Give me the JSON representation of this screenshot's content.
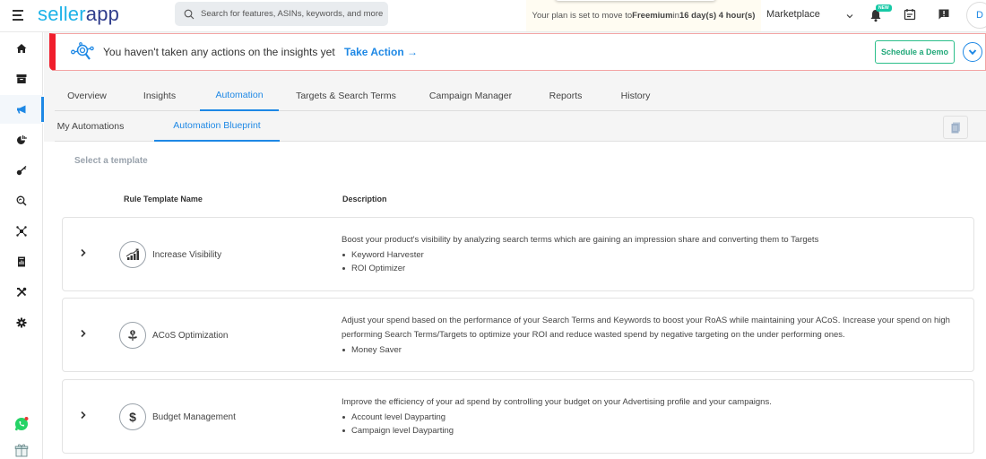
{
  "topbar": {
    "logo_part1": "seller",
    "logo_part2": "app",
    "search_placeholder": "Search for features, ASINs, keywords, and more",
    "plan_text_pre": "Your plan is set to move to ",
    "plan_name": "Freemium",
    "plan_text_mid": " in ",
    "plan_time": "16 day(s) 4 hour(s)",
    "marketplace_label": "Marketplace",
    "new_badge": "NEW",
    "avatar_initial": "D"
  },
  "sidebar": {
    "items": [
      {
        "name": "home",
        "icon": "home-icon"
      },
      {
        "name": "inventory",
        "icon": "archive-icon"
      },
      {
        "name": "advertising",
        "icon": "megaphone-icon",
        "active": true
      },
      {
        "name": "analytics",
        "icon": "pie-chart-icon"
      },
      {
        "name": "keywords",
        "icon": "key-icon"
      },
      {
        "name": "product-research",
        "icon": "search-zoom-icon"
      },
      {
        "name": "integrations",
        "icon": "network-icon"
      },
      {
        "name": "reports",
        "icon": "report-icon"
      },
      {
        "name": "tools",
        "icon": "tools-icon"
      },
      {
        "name": "settings",
        "icon": "gear-icon"
      }
    ],
    "bottom": [
      "whatsapp-icon",
      "gift-icon"
    ]
  },
  "banner": {
    "message": "You haven't taken any actions on the insights yet",
    "action_label": "Take Action →",
    "demo_button": "Schedule a Demo"
  },
  "tabs": [
    {
      "label": "Overview"
    },
    {
      "label": "Insights"
    },
    {
      "label": "Automation",
      "active": true
    },
    {
      "label": "Targets & Search Terms"
    },
    {
      "label": "Campaign Manager"
    },
    {
      "label": "Reports"
    },
    {
      "label": "History"
    }
  ],
  "subtabs": [
    {
      "label": "My Automations"
    },
    {
      "label": "Automation Blueprint",
      "active": true
    }
  ],
  "content": {
    "select_label": "Select a template",
    "columns": {
      "name": "Rule Template Name",
      "description": "Description"
    },
    "templates": [
      {
        "name": "Increase Visibility",
        "icon": "growth-chart-icon",
        "description": "Boost your product's visibility by analyzing search terms which are gaining an impression share and converting them to Targets",
        "rules": [
          "Keyword Harvester",
          "ROI Optimizer"
        ]
      },
      {
        "name": "ACoS Optimization",
        "icon": "money-plant-icon",
        "description": "Adjust your spend based on the performance of your Search Terms and Keywords to boost your RoAS while maintaining your ACoS. Increase your spend on high performing Search Terms/Targets to optimize your ROI and reduce wasted spend by negative targeting on the under performing ones.",
        "rules": [
          "Money Saver"
        ]
      },
      {
        "name": "Budget Management",
        "icon": "dollar-icon",
        "description": "Improve the efficiency of your ad spend by controlling your budget on your Advertising profile and your campaigns.",
        "rules": [
          "Account level Dayparting",
          "Campaign level Dayparting"
        ]
      }
    ]
  },
  "colors": {
    "accent": "#1e88e5",
    "logo_light": "#1fb3e8",
    "logo_dark": "#2f3d8c",
    "alert_red": "#f01e2c",
    "demo_green": "#21a879"
  }
}
